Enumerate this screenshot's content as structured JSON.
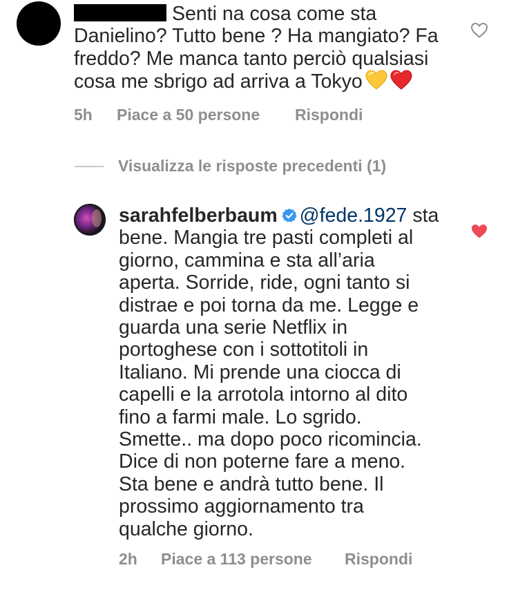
{
  "top_comment": {
    "text": "Senti na cosa come sta\nDanielino? Tutto bene ? Ha mangiato? Fa\nfreddo? Me manca tanto perciò qualsiasi\ncosa me sbrigo ad arriva a Tokyo",
    "emojis": [
      "yellow-heart-emoji",
      "red-heart-emoji"
    ],
    "time": "5h",
    "likes": "Piace a 50 persone",
    "reply_label": "Rispondi",
    "like_icon": "heart-outline-icon"
  },
  "view_replies": {
    "label": "Visualizza le risposte precedenti (1)"
  },
  "reply_comment": {
    "username": "sarahfelberbaum",
    "verified_icon": "verified-badge-icon",
    "mention": "@fede.1927",
    "text_first": " sta",
    "text": "bene. Mangia tre pasti completi al\ngiorno, cammina e sta all’aria\naperta. Sorride, ride, ogni tanto si\ndistrae e poi torna da me. Legge e\nguarda una serie Netflix in\nportoghese con i sottotitoli in\nItaliano. Mi prende una ciocca di\ncapelli e la arrotola intorno al dito\nfino a farmi male. Lo sgrido.\nSmette.. ma dopo poco ricomincia.\nDice di non poterne fare a meno.\nSta bene e andrà tutto bene. Il\nprossimo aggiornamento tra\nqualche giorno.",
    "time": "2h",
    "likes": "Piace a 113 persone",
    "reply_label": "Rispondi",
    "like_icon": "heart-filled-icon",
    "like_color": "#ed4956"
  },
  "colors": {
    "text": "#262626",
    "secondary": "#8e8e8e",
    "mention": "#003569",
    "verified": "#3897f0",
    "liked": "#ed4956"
  }
}
